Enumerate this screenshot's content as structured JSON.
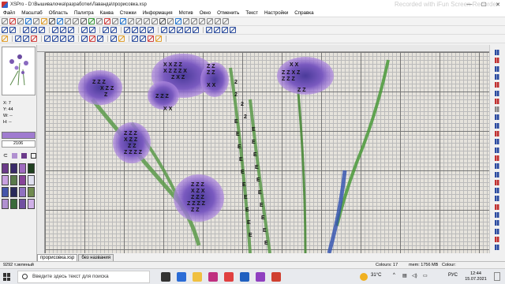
{
  "window": {
    "title": "XSPro - D:\\Вышивалочка\\разработки\\Лаванда\\прорисовка.xsp",
    "watermark": "Recorded with iFun Screen Recorder",
    "minimize": "—",
    "maximize": "☐",
    "close": "✕"
  },
  "menu": [
    "Файл",
    "Масштаб",
    "Область",
    "Палитра",
    "Канва",
    "Стежки",
    "Информация",
    "Мотив",
    "Окно",
    "Отменить",
    "Текст",
    "Настройки",
    "Справка"
  ],
  "sidebar": {
    "coords": [
      "X: 7",
      "Y: 44",
      "W: --",
      "H: --"
    ],
    "color_code": "2106",
    "palette_colors": [
      "#6b3a8a",
      "#3a2a6a",
      "#a06bc0",
      "#1f3f1f",
      "#c8a0e0",
      "#5a7a4a",
      "#884499",
      "#e0e0f0",
      "#4455aa",
      "#2a2a5a",
      "#9070c0",
      "#708a50",
      "#b090d0",
      "#3a6a3a",
      "#7050a0",
      "#d0b0e8"
    ]
  },
  "tabs": [
    "прорисовка.xsp",
    "без названия"
  ],
  "status": {
    "left": "9292 т.зеленый",
    "colours": "Colours: 17",
    "mem": "mem: 1756 MB",
    "colour": "Colour:"
  },
  "taskbar": {
    "search_placeholder": "Введите здесь текст для поиска",
    "weather": "31°C",
    "lang": "РУС",
    "time": "12:44",
    "date": "15.07.2021"
  }
}
